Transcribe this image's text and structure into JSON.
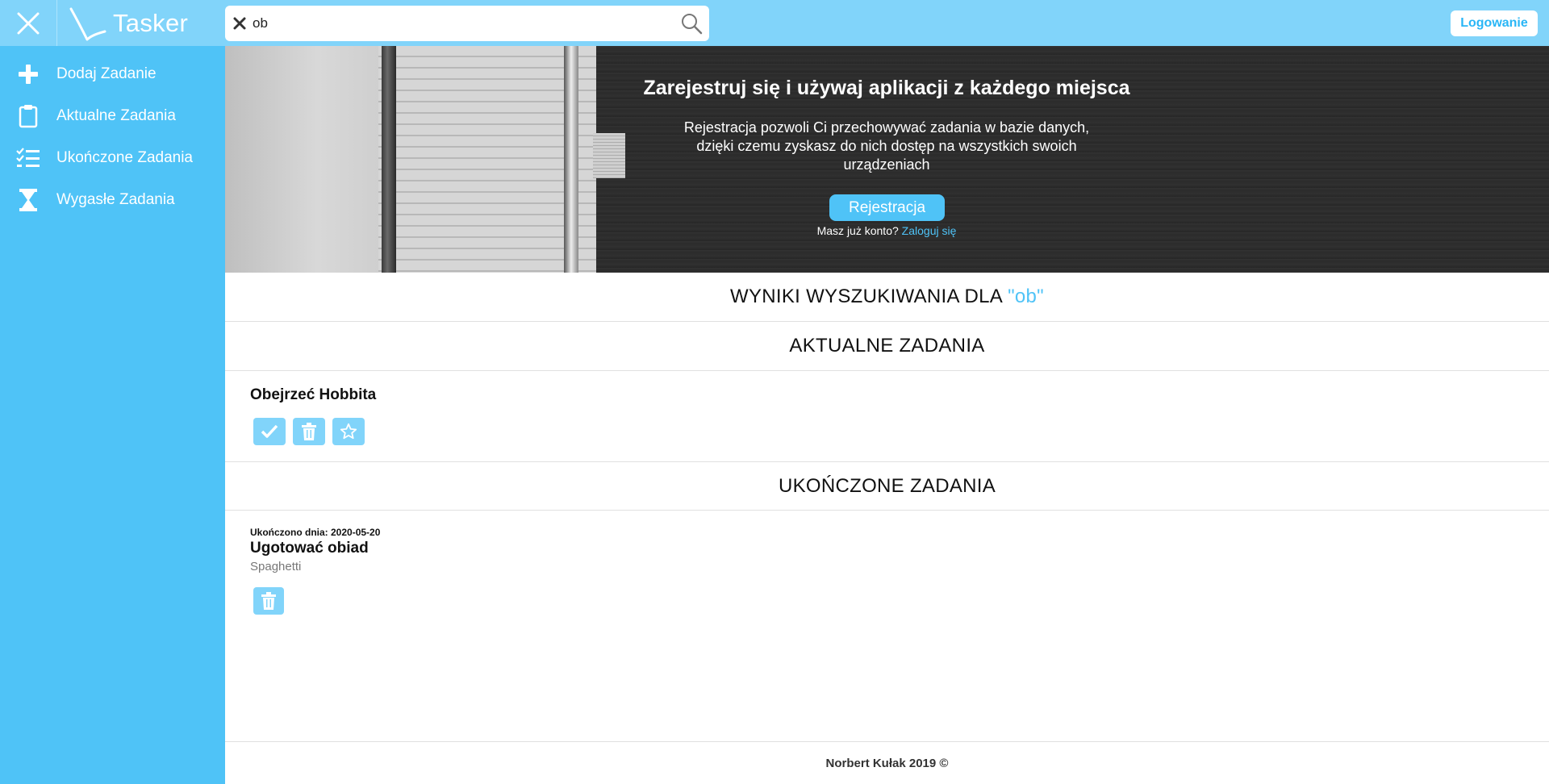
{
  "app": {
    "name": "Tasker"
  },
  "colors": {
    "accent": "#4fc3f7",
    "topbar": "#81d4fa",
    "sidebar": "#4fc3f7"
  },
  "header": {
    "close_icon": "close-icon",
    "search": {
      "value": "ob",
      "placeholder": ""
    },
    "login_label": "Logowanie"
  },
  "sidebar": {
    "items": [
      {
        "label": "Dodaj Zadanie",
        "icon": "plus-icon"
      },
      {
        "label": "Aktualne Zadania",
        "icon": "clipboard-icon"
      },
      {
        "label": "Ukończone Zadania",
        "icon": "checklist-icon"
      },
      {
        "label": "Wygasłe Zadania",
        "icon": "hourglass-icon"
      }
    ]
  },
  "hero": {
    "title": "Zarejestruj się i używaj aplikacji z każdego miejsca",
    "text": "Rejestracja pozwoli Ci przechowywać zadania w bazie danych, dzięki czemu zyskasz do nich dostęp na wszystkich swoich urządzeniach",
    "register_label": "Rejestracja",
    "have_account": "Masz już konto?",
    "login_link": "Zaloguj się"
  },
  "results": {
    "heading_prefix": "WYNIKI WYSZUKIWANIA DLA",
    "query_display": "\"ob\""
  },
  "current": {
    "heading": "AKTUALNE ZADANIA",
    "tasks": [
      {
        "title": "Obejrzeć Hobbita"
      }
    ]
  },
  "completed": {
    "heading": "UKOŃCZONE ZADANIA",
    "tasks": [
      {
        "done_label": "Ukończono dnia: 2020-05-20",
        "title": "Ugotować obiad",
        "description": "Spaghetti"
      }
    ]
  },
  "footer": {
    "text": "Norbert Kułak 2019 ©"
  }
}
